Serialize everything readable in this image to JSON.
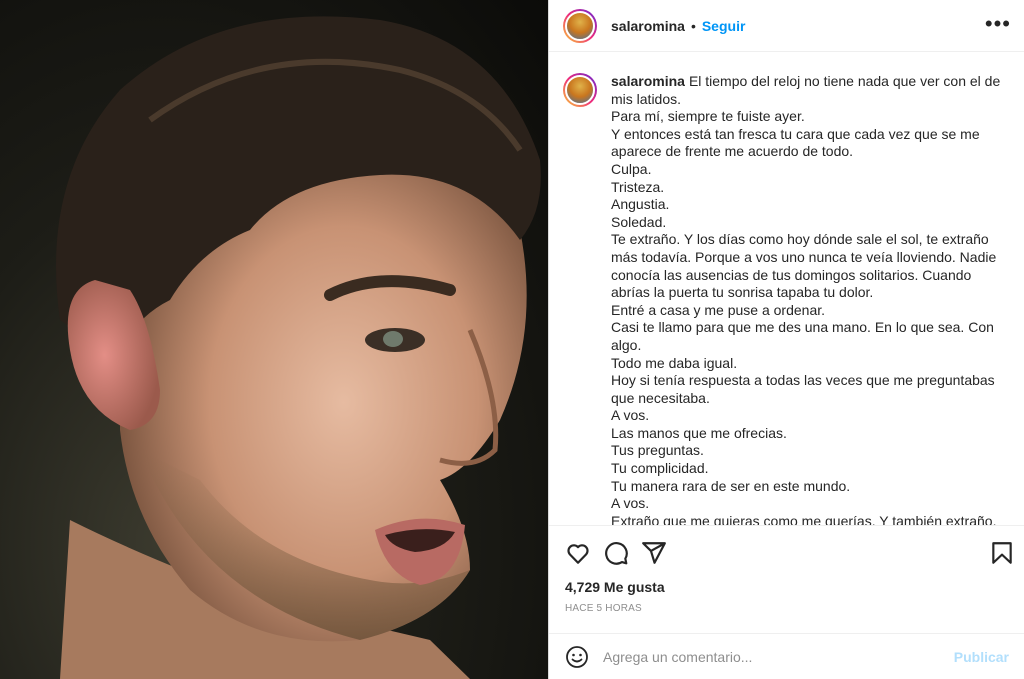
{
  "header": {
    "username": "salaromina",
    "separator": "•",
    "follow_label": "Seguir",
    "more_label": "•••"
  },
  "caption": {
    "username": "salaromina",
    "lines": [
      "El tiempo del reloj no tiene nada que ver con el de mis latidos.",
      "Para mí, siempre te fuiste ayer.",
      "Y entonces está tan fresca tu cara que cada vez que se me aparece de frente me acuerdo de todo.",
      "Culpa.",
      "Tristeza.",
      "Angustia.",
      "Soledad.",
      "Te extraño. Y los días como hoy dónde sale el sol, te extraño más todavía. Porque a vos uno nunca te veía lloviendo. Nadie conocía las ausencias de tus domingos solitarios. Cuando abrías la puerta tu sonrisa tapaba tu dolor.",
      "Entré a casa y me puse a ordenar.",
      "Casi te llamo para que me des una mano. En lo que sea. Con algo.",
      "Todo me daba igual.",
      "Hoy si tenía respuesta a todas las veces que me preguntabas que necesitaba.",
      "A vos.",
      "Las manos que me ofrecias.",
      "Tus preguntas.",
      "Tu complicidad.",
      "Tu manera rara de ser en este mundo.",
      "A vos.",
      "Extraño que me quieras como me querías. Y también extraño, la inocencia de pensar que podía llamarte en otro momento."
    ]
  },
  "actions": {
    "icons": [
      "heart-icon",
      "comment-icon",
      "share-icon",
      "bookmark-icon"
    ]
  },
  "likes": "4,729 Me gusta",
  "timestamp": "HACE 5 HORAS",
  "comment_box": {
    "placeholder": "Agrega un comentario...",
    "publish_label": "Publicar"
  },
  "colors": {
    "accent": "#0095f6",
    "publish_disabled": "#b2dffc",
    "text": "#262626",
    "muted": "#8e8e8e"
  }
}
